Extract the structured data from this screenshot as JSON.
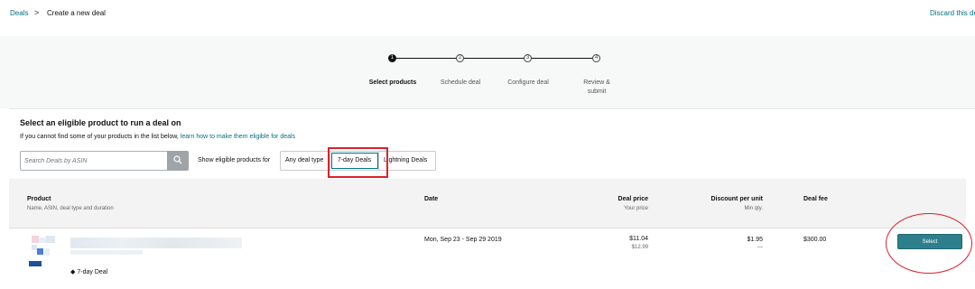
{
  "breadcrumb": {
    "link": "Deals",
    "separator": ">",
    "current": "Create a new deal"
  },
  "header": {
    "discard_label": "Discard this deal"
  },
  "stepper": {
    "steps": [
      {
        "number": "1",
        "label": "Select products",
        "active": true
      },
      {
        "number": "2",
        "label": "Schedule deal",
        "active": false
      },
      {
        "number": "3",
        "label": "Configure deal",
        "active": false
      },
      {
        "number": "4",
        "label": "Review & submit",
        "active": false
      }
    ]
  },
  "main": {
    "heading": "Select an eligible product to run a deal on",
    "subline_text": "If you cannot find some of your products in the list below,",
    "subline_link": "learn how to make them eligible for deals",
    "search": {
      "placeholder": "Search Deals by ASIN",
      "value": "",
      "icon": "search-icon"
    },
    "filter": {
      "label": "Show eligible products for",
      "options": [
        "Any deal type",
        "7-day Deals",
        "Lightning Deals"
      ],
      "selected": "7-day Deals"
    }
  },
  "table": {
    "columns": [
      {
        "title": "Product",
        "sub": "Name, ASIN, deal type and duration"
      },
      {
        "title": "Date",
        "sub": ""
      },
      {
        "title": "Deal price",
        "sub": "Your price"
      },
      {
        "title": "Discount per unit",
        "sub": "Min qty."
      },
      {
        "title": "Deal fee",
        "sub": ""
      }
    ],
    "rows": [
      {
        "deal_type": "7-day Deal",
        "date": "Mon, Sep 23 - Sep 29 2019",
        "deal_price": "$11.04",
        "your_price": "$12.99",
        "discount": "$1.95",
        "min_qty": "—",
        "deal_fee": "$300.00",
        "action_label": "Select"
      }
    ]
  },
  "colors": {
    "link": "#007185",
    "accent_button": "#2d7f8c",
    "annotation_red": "#d9232d"
  }
}
